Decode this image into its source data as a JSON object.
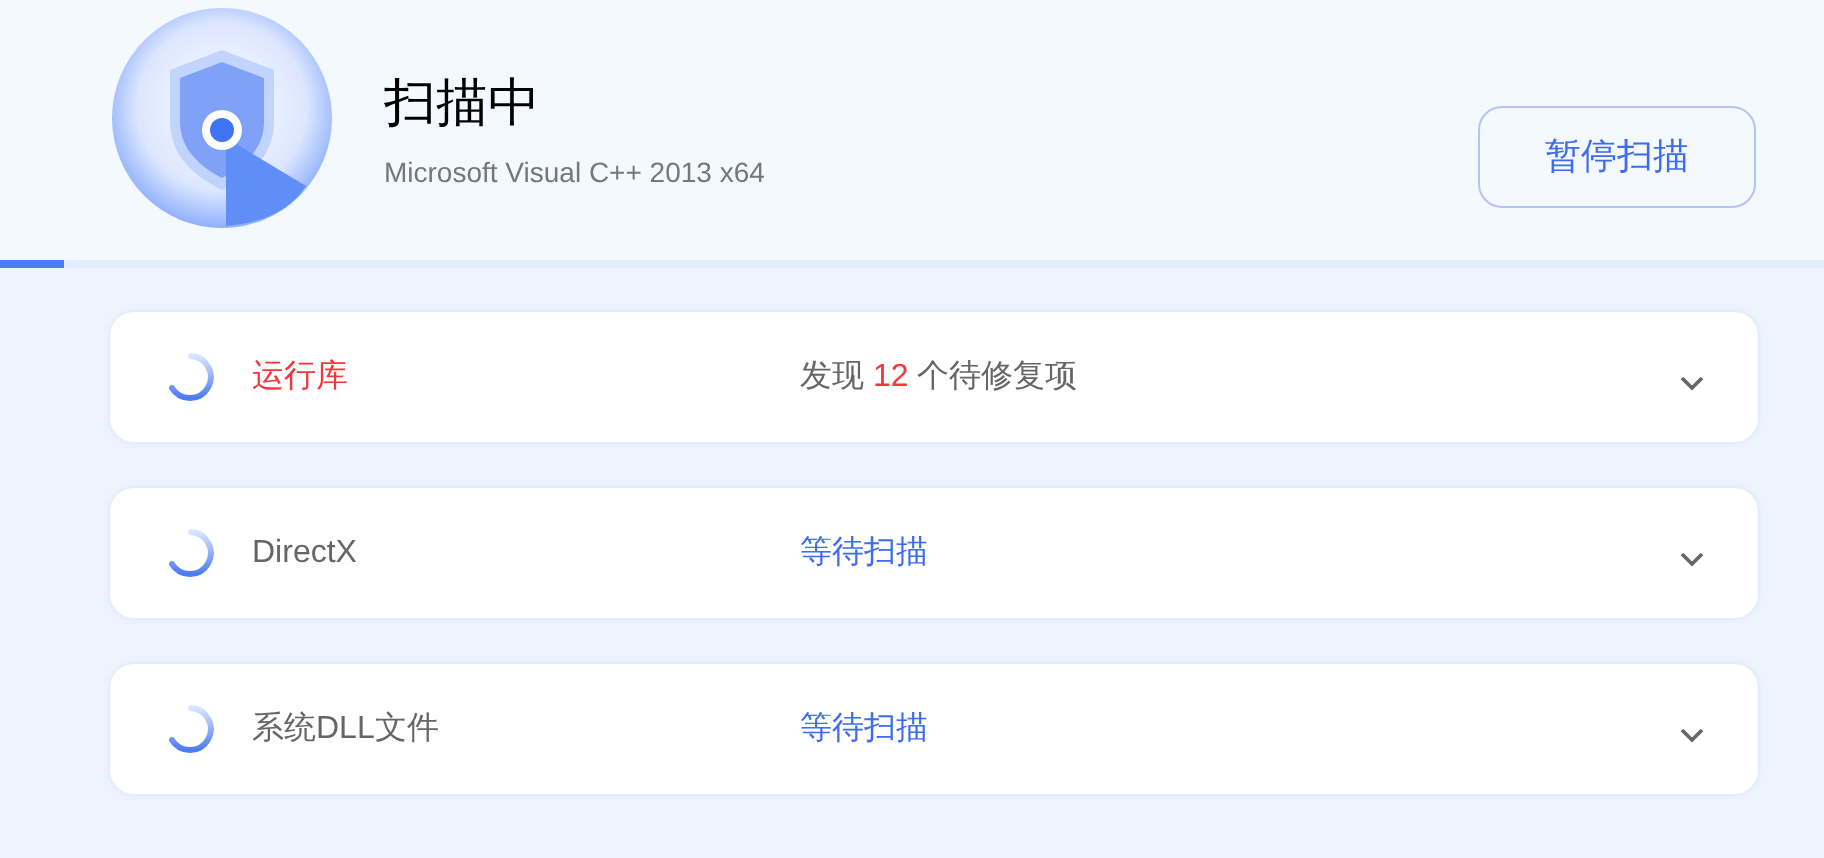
{
  "header": {
    "title": "扫描中",
    "subtitle": "Microsoft Visual C++ 2013 x64",
    "button": "暂停扫描"
  },
  "progress": {
    "level": 0.035
  },
  "items": [
    {
      "name": "运行库",
      "alert": true,
      "kind": "found",
      "status_prefix": "发现",
      "count": "12",
      "status_suffix": "个待修复项"
    },
    {
      "name": "DirectX",
      "alert": false,
      "kind": "waiting",
      "status": "等待扫描"
    },
    {
      "name": "系统DLL文件",
      "alert": false,
      "kind": "waiting",
      "status": "等待扫描"
    }
  ]
}
